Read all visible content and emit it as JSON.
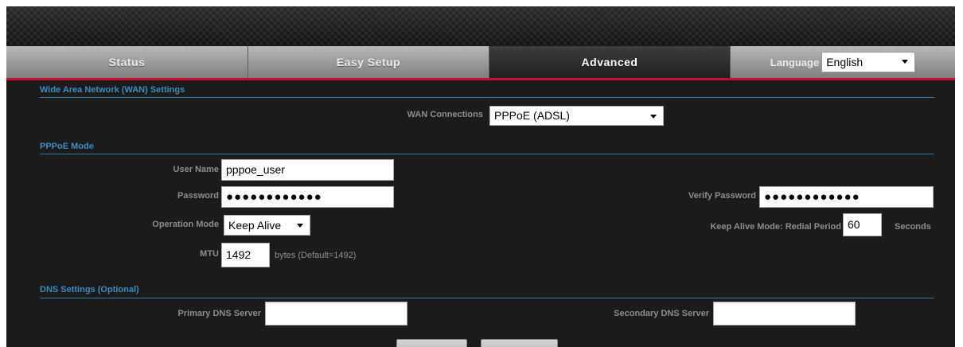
{
  "nav": {
    "tabs": [
      {
        "label": "Status"
      },
      {
        "label": "Easy Setup"
      },
      {
        "label": "Advanced"
      }
    ],
    "language_label": "Language",
    "language_value": "English"
  },
  "wan": {
    "section_title": "Wide Area Network (WAN) Settings",
    "connections_label": "WAN Connections",
    "connections_value": "PPPoE (ADSL)"
  },
  "pppoe": {
    "section_title": "PPPoE Mode",
    "username_label": "User Name",
    "username_value": "pppoe_user",
    "password_label": "Password",
    "password_value": "●●●●●●●●●●●●",
    "verify_password_label": "Verify Password",
    "verify_password_value": "●●●●●●●●●●●●",
    "operation_mode_label": "Operation Mode",
    "operation_mode_value": "Keep Alive",
    "keepalive_label": "Keep Alive Mode: Redial Period",
    "keepalive_value": "60",
    "keepalive_unit": "Seconds",
    "mtu_label": "MTU",
    "mtu_value": "1492",
    "mtu_hint": "bytes (Default=1492)"
  },
  "dns": {
    "section_title": "DNS Settings (Optional)",
    "primary_label": "Primary DNS Server",
    "primary_value": "",
    "secondary_label": "Secondary DNS Server",
    "secondary_value": ""
  },
  "colors": {
    "accent_red": "#c8102e",
    "section_blue": "#3d8bc0",
    "background": "#1b1b1b"
  }
}
